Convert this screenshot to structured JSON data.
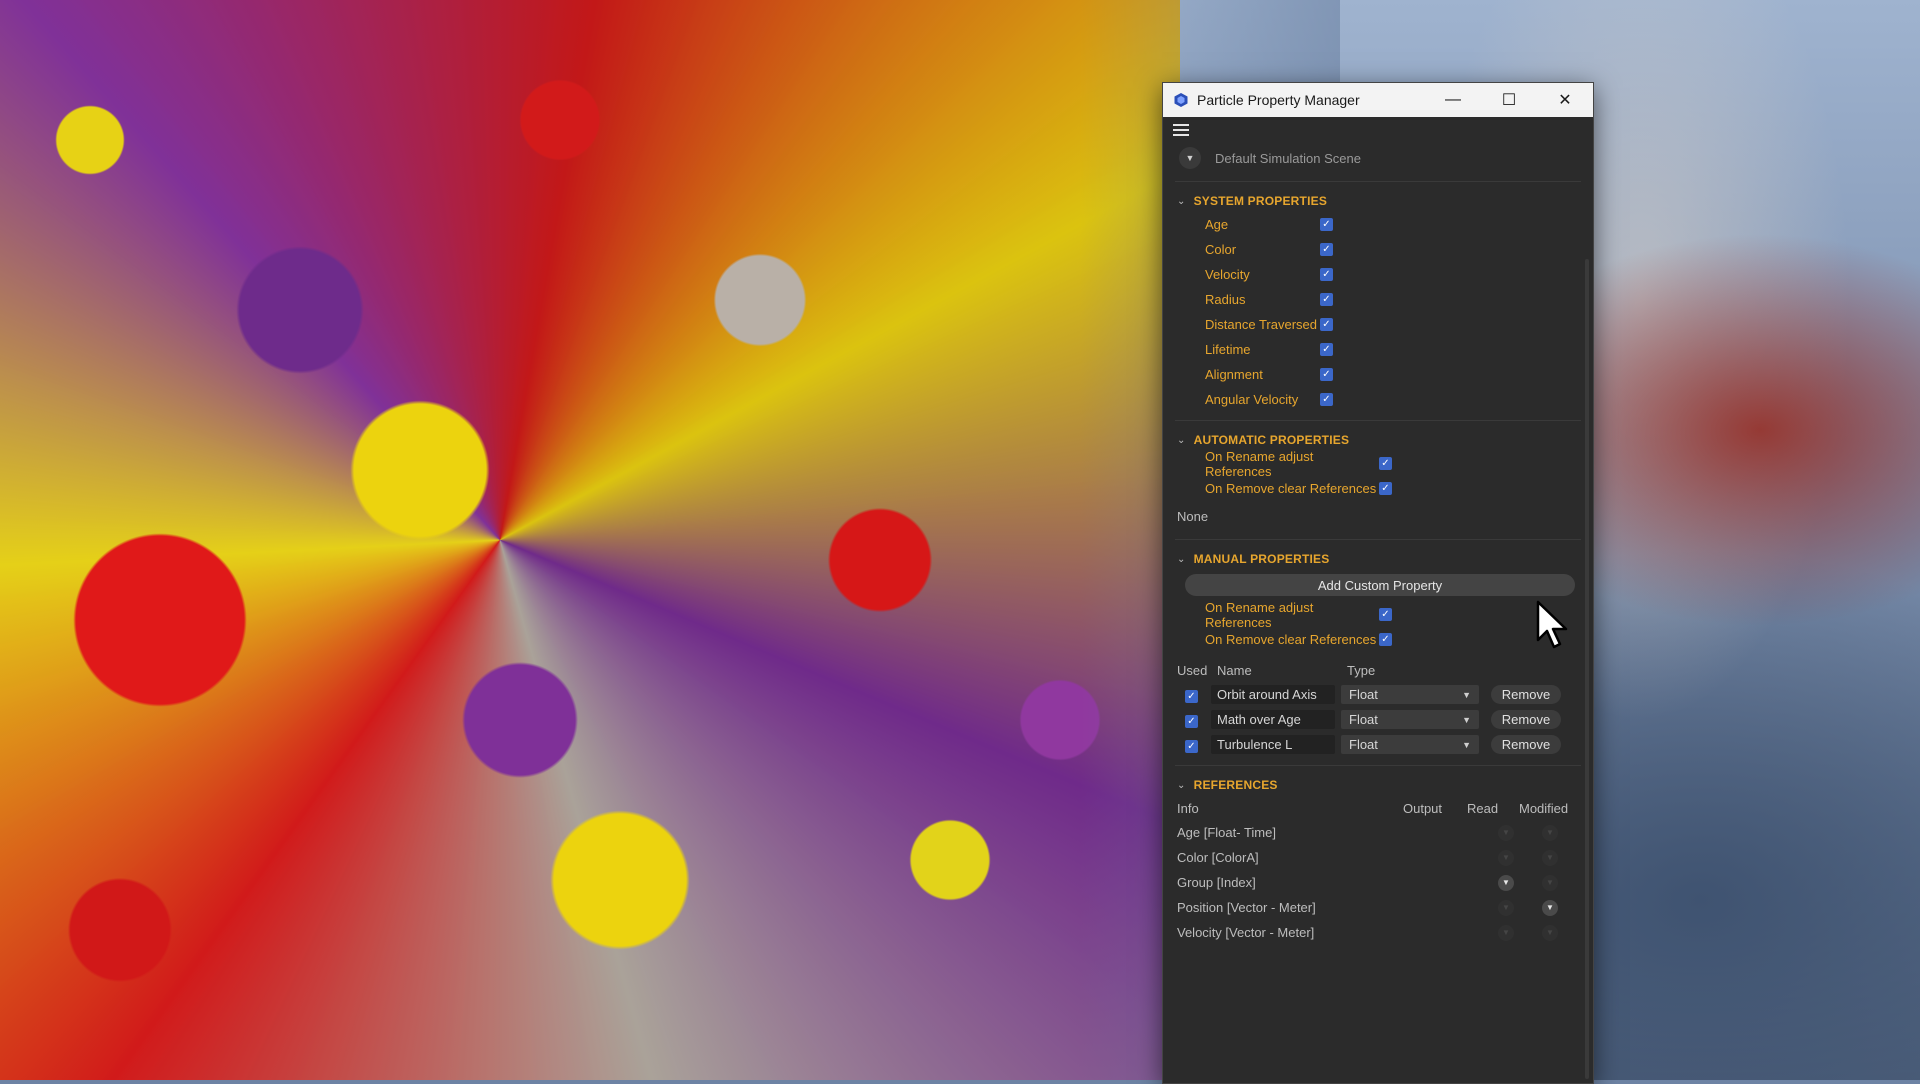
{
  "window": {
    "title": "Particle Property Manager",
    "minimize": "—",
    "maximize": "☐",
    "close": "✕"
  },
  "scene": {
    "name": "Default Simulation Scene"
  },
  "system_properties": {
    "header": "SYSTEM PROPERTIES",
    "items": [
      {
        "label": "Age",
        "checked": true
      },
      {
        "label": "Color",
        "checked": true
      },
      {
        "label": "Velocity",
        "checked": true
      },
      {
        "label": "Radius",
        "checked": true
      },
      {
        "label": "Distance Traversed",
        "checked": true
      },
      {
        "label": "Lifetime",
        "checked": true
      },
      {
        "label": "Alignment",
        "checked": true
      },
      {
        "label": "Angular Velocity",
        "checked": true
      }
    ]
  },
  "automatic_properties": {
    "header": "AUTOMATIC PROPERTIES",
    "items": [
      {
        "label": "On Rename adjust References",
        "checked": true
      },
      {
        "label": "On Remove clear References",
        "checked": true
      }
    ],
    "none_label": "None"
  },
  "manual_properties": {
    "header": "MANUAL PROPERTIES",
    "add_button": "Add Custom Property",
    "items": [
      {
        "label": "On Rename adjust References",
        "checked": true
      },
      {
        "label": "On Remove clear References",
        "checked": true
      }
    ],
    "table": {
      "headers": {
        "used": "Used",
        "name": "Name",
        "type": "Type"
      },
      "rows": [
        {
          "used": true,
          "name": "Orbit around Axis",
          "type": "Float",
          "remove": "Remove"
        },
        {
          "used": true,
          "name": "Math over Age",
          "type": "Float",
          "remove": "Remove"
        },
        {
          "used": true,
          "name": "Turbulence L",
          "type": "Float",
          "remove": "Remove"
        }
      ]
    }
  },
  "references": {
    "header": "REFERENCES",
    "headers": {
      "info": "Info",
      "output": "Output",
      "read": "Read",
      "modified": "Modified"
    },
    "rows": [
      {
        "info": "Age [Float- Time]",
        "read": false,
        "modified": false
      },
      {
        "info": "Color [ColorA]",
        "read": false,
        "modified": false
      },
      {
        "info": "Group [Index]",
        "read": true,
        "modified": false
      },
      {
        "info": "Position [Vector - Meter]",
        "read": false,
        "modified": true
      },
      {
        "info": "Velocity [Vector - Meter]",
        "read": false,
        "modified": false
      }
    ]
  },
  "icons": {
    "check": "✓",
    "chevron": "⌄",
    "dropdown": "▼"
  },
  "colors": {
    "accent": "#e7a62e",
    "checkbox": "#3b67c9",
    "panel_bg": "#2b2b2b",
    "titlebar_bg": "#f3f3f3"
  }
}
